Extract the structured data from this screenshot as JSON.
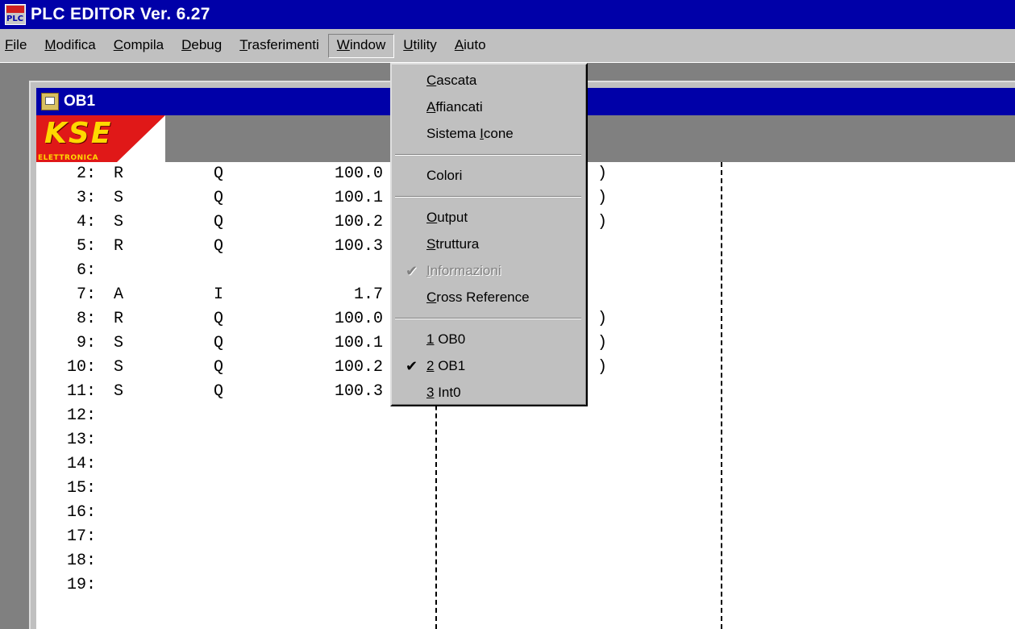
{
  "window": {
    "title": "PLC EDITOR Ver. 6.27",
    "app_icon_text": "PLC"
  },
  "menubar": {
    "items": [
      {
        "key": "F",
        "rest": "ile"
      },
      {
        "key": "M",
        "rest": "odifica"
      },
      {
        "key": "C",
        "rest": "ompila"
      },
      {
        "key": "D",
        "rest": "ebug"
      },
      {
        "key": "T",
        "rest": "rasferimenti"
      },
      {
        "key": "W",
        "rest": "indow"
      },
      {
        "key": "U",
        "rest": "tility"
      },
      {
        "key": "A",
        "rest": "iuto"
      }
    ]
  },
  "child": {
    "title": "OB1",
    "logo": {
      "main": "KSE",
      "sub": "ELETTRONICA"
    }
  },
  "code": [
    {
      "n": "2",
      "op": "R",
      "type": "Q",
      "addr": "100.0",
      "paren": ")"
    },
    {
      "n": "3",
      "op": "S",
      "type": "Q",
      "addr": "100.1",
      "paren": ")"
    },
    {
      "n": "4",
      "op": "S",
      "type": "Q",
      "addr": "100.2",
      "paren": ")"
    },
    {
      "n": "5",
      "op": "R",
      "type": "Q",
      "addr": "100.3",
      "paren": ""
    },
    {
      "n": "6",
      "op": "",
      "type": "",
      "addr": "",
      "paren": ""
    },
    {
      "n": "7",
      "op": "A",
      "type": "I",
      "addr": "1.7",
      "paren": ""
    },
    {
      "n": "8",
      "op": "R",
      "type": "Q",
      "addr": "100.0",
      "paren": ")"
    },
    {
      "n": "9",
      "op": "S",
      "type": "Q",
      "addr": "100.1",
      "paren": ")"
    },
    {
      "n": "10",
      "op": "S",
      "type": "Q",
      "addr": "100.2",
      "paren": ")"
    },
    {
      "n": "11",
      "op": "S",
      "type": "Q",
      "addr": "100.3",
      "paren": ""
    },
    {
      "n": "12",
      "op": "",
      "type": "",
      "addr": "",
      "paren": ""
    },
    {
      "n": "13",
      "op": "",
      "type": "",
      "addr": "",
      "paren": ""
    },
    {
      "n": "14",
      "op": "",
      "type": "",
      "addr": "",
      "paren": ""
    },
    {
      "n": "15",
      "op": "",
      "type": "",
      "addr": "",
      "paren": ""
    },
    {
      "n": "16",
      "op": "",
      "type": "",
      "addr": "",
      "paren": ""
    },
    {
      "n": "17",
      "op": "",
      "type": "",
      "addr": "",
      "paren": ""
    },
    {
      "n": "18",
      "op": "",
      "type": "",
      "addr": "",
      "paren": ""
    },
    {
      "n": "19",
      "op": "",
      "type": "",
      "addr": "",
      "paren": ""
    }
  ],
  "window_menu": {
    "groups": [
      [
        {
          "pre": "",
          "key": "C",
          "rest": "ascata",
          "checked": false,
          "disabled": false
        },
        {
          "pre": "",
          "key": "A",
          "rest": "ffiancati",
          "checked": false,
          "disabled": false
        },
        {
          "pre": "Sistema ",
          "key": "I",
          "rest": "cone",
          "checked": false,
          "disabled": false
        }
      ],
      [
        {
          "pre": "Colori",
          "key": "",
          "rest": "",
          "checked": false,
          "disabled": false
        }
      ],
      [
        {
          "pre": "",
          "key": "O",
          "rest": "utput",
          "checked": false,
          "disabled": false
        },
        {
          "pre": "",
          "key": "S",
          "rest": "truttura",
          "checked": false,
          "disabled": false
        },
        {
          "pre": "",
          "key": "I",
          "rest": "nformazioni",
          "checked": true,
          "disabled": true
        },
        {
          "pre": "",
          "key": "C",
          "rest": "ross Reference",
          "checked": false,
          "disabled": false
        }
      ],
      [
        {
          "pre": "",
          "key": "1",
          "rest": " OB0",
          "checked": false,
          "disabled": false
        },
        {
          "pre": "",
          "key": "2",
          "rest": " OB1",
          "checked": true,
          "disabled": false
        },
        {
          "pre": "",
          "key": "3",
          "rest": " Int0",
          "checked": false,
          "disabled": false
        }
      ]
    ],
    "check_glyph": "✔"
  },
  "colors": {
    "title_bar": "#0000a8",
    "face": "#c0c0c0",
    "workspace": "#808080"
  }
}
